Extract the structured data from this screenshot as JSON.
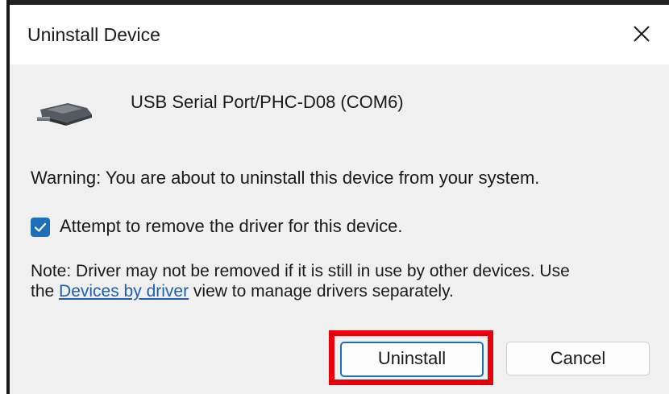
{
  "window": {
    "title": "Uninstall Device",
    "close_icon": "close-icon"
  },
  "device": {
    "icon": "usb-serial-device-icon",
    "name": "USB Serial Port/PHC-D08 (COM6)"
  },
  "warning_text": "Warning: You are about to uninstall this device from your system.",
  "option": {
    "checked": true,
    "label": "Attempt to remove the driver for this device."
  },
  "note": {
    "prefix": "Note: Driver may not be removed if it is still in use by other devices. Use the ",
    "link_text": "Devices by driver",
    "suffix": " view to manage drivers separately."
  },
  "buttons": {
    "uninstall": "Uninstall",
    "cancel": "Cancel"
  },
  "colors": {
    "accent": "#1d6fba",
    "highlight": "#e8000b",
    "link": "#1a5fb4"
  }
}
